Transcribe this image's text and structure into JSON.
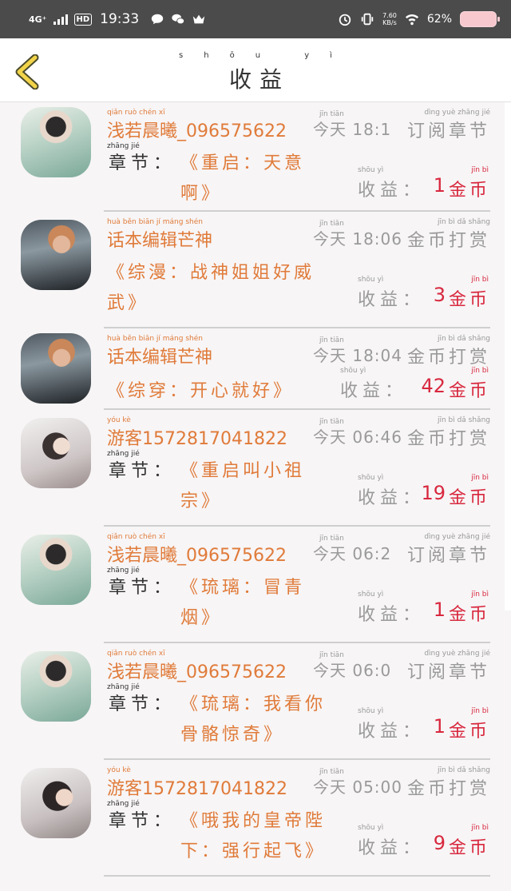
{
  "status": {
    "network": "4G⁺",
    "hd": "HD",
    "time": "19:33",
    "speed_value": "7.60",
    "speed_unit": "KB/s",
    "battery": "62%"
  },
  "header": {
    "title": "收益",
    "title_pinyin": "shōu yì"
  },
  "labels": {
    "chapter": "章节：",
    "chapter_pinyin": "zhāng jié",
    "income": "收益：",
    "income_pinyin": "shōu yì",
    "coin": "金币",
    "coin_pinyin": "jīn bì",
    "today_pinyin": "jīn tiān"
  },
  "records": [
    {
      "user": "浅若晨曦_096575622",
      "user_pinyin": "qiǎn ruò chén xī",
      "when": "今天 18:1",
      "type": "订阅章节",
      "type_pinyin": "dìng yuè zhāng jié",
      "chapter": "《重启：天意啊》",
      "has_chapter_label": true,
      "amount": "1",
      "avatar": "woman-green-dress"
    },
    {
      "user": "话本编辑芒神",
      "user_pinyin": "huà běn biān jí máng shén",
      "when": "今天 18:06",
      "type": "金币打赏",
      "type_pinyin": "jīn bì dǎ shǎng",
      "chapter": "《综漫：战神姐姐好威武》",
      "has_chapter_label": false,
      "amount": "3",
      "avatar": "woman-sunglasses"
    },
    {
      "user": "话本编辑芒神",
      "user_pinyin": "huà běn biān jí máng shén",
      "when": "今天 18:04",
      "type": "金币打赏",
      "type_pinyin": "jīn bì dǎ shǎng",
      "chapter": "《综穿：开心就好》",
      "has_chapter_label": false,
      "amount": "42",
      "avatar": "woman-sunglasses"
    },
    {
      "user": "游客1572817041822",
      "user_pinyin": "yóu kè",
      "when": "今天 06:46",
      "type": "金币打赏",
      "type_pinyin": "jīn bì dǎ shǎng",
      "chapter": "《重启叫小祖宗》",
      "has_chapter_label": true,
      "amount": "19",
      "avatar": "woman-white-veil"
    },
    {
      "user": "浅若晨曦_096575622",
      "user_pinyin": "qiǎn ruò chén xī",
      "when": "今天 06:2",
      "type": "订阅章节",
      "type_pinyin": "dìng yuè zhāng jié",
      "chapter": "《琉璃：冒青烟》",
      "has_chapter_label": true,
      "amount": "1",
      "avatar": "woman-green-dress"
    },
    {
      "user": "浅若晨曦_096575622",
      "user_pinyin": "qiǎn ruò chén xī",
      "when": "今天 06:0",
      "type": "订阅章节",
      "type_pinyin": "dìng yuè zhāng jié",
      "chapter": "《琉璃：我看你骨骼惊奇》",
      "has_chapter_label": true,
      "amount": "1",
      "avatar": "woman-green-dress"
    },
    {
      "user": "游客1572817041822",
      "user_pinyin": "yóu kè",
      "when": "今天 05:00",
      "type": "金币打赏",
      "type_pinyin": "jīn bì dǎ shǎng",
      "chapter": "《哦我的皇帝陛下：强行起飞》",
      "has_chapter_label": true,
      "amount": "9",
      "avatar": "woman-dark-hair"
    }
  ],
  "colors": {
    "orange": "#e07b3a",
    "red": "#d8283e",
    "gray": "#9a9a9a",
    "status_bar": "#4b4b4b"
  }
}
